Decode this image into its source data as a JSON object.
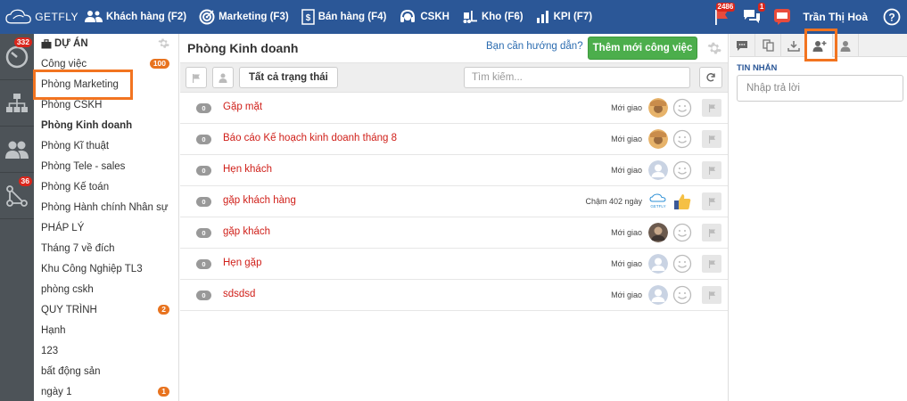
{
  "brand": {
    "name": "GETFLY"
  },
  "nav": [
    {
      "label": "Khách hàng (F2)",
      "icon": "users-icon"
    },
    {
      "label": "Marketing (F3)",
      "icon": "target-icon"
    },
    {
      "label": "Bán hàng (F4)",
      "icon": "dollar-doc-icon"
    },
    {
      "label": "CSKH",
      "icon": "headset-icon"
    },
    {
      "label": "Kho (F6)",
      "icon": "forklift-icon"
    },
    {
      "label": "KPI (F7)",
      "icon": "chart-icon"
    }
  ],
  "top_right": {
    "flag_badge": "2486",
    "chat_badge": "1",
    "user_name": "Trần Thị Hoà"
  },
  "rail": [
    {
      "icon": "dashboard-icon",
      "badge": "332"
    },
    {
      "icon": "org-chart-icon",
      "badge": ""
    },
    {
      "icon": "people-icon",
      "badge": ""
    },
    {
      "icon": "workflow-icon",
      "badge": "36"
    }
  ],
  "projects": {
    "header": "DỰ ÁN",
    "items": [
      {
        "label": "Công việc",
        "count": "100",
        "bold": false
      },
      {
        "label": "Phòng Marketing",
        "count": "",
        "bold": false
      },
      {
        "label": "Phòng CSKH",
        "count": "",
        "bold": false
      },
      {
        "label": "Phòng Kinh doanh",
        "count": "",
        "bold": true
      },
      {
        "label": "Phòng Kĩ thuật",
        "count": "",
        "bold": false
      },
      {
        "label": "Phòng Tele - sales",
        "count": "",
        "bold": false
      },
      {
        "label": "Phòng Kế toán",
        "count": "",
        "bold": false
      },
      {
        "label": "Phòng Hành chính Nhân sự",
        "count": "",
        "bold": false
      },
      {
        "label": "PHÁP LÝ",
        "count": "",
        "bold": false
      },
      {
        "label": "Tháng 7 về đích",
        "count": "",
        "bold": false
      },
      {
        "label": "Khu Công Nghiệp TL3",
        "count": "",
        "bold": false
      },
      {
        "label": "phòng cskh",
        "count": "",
        "bold": false
      },
      {
        "label": "QUY TRÌNH",
        "count": "2",
        "bold": false
      },
      {
        "label": "Hạnh",
        "count": "",
        "bold": false
      },
      {
        "label": "123",
        "count": "",
        "bold": false
      },
      {
        "label": "bất động sản",
        "count": "",
        "bold": false
      },
      {
        "label": "ngày 1",
        "count": "1",
        "bold": false
      }
    ]
  },
  "main": {
    "title": "Phòng Kinh doanh",
    "guide_link": "Bạn cần hướng dẫn?",
    "add_button": "Thêm mới công việc",
    "status_filter": "Tất cả trạng thái",
    "search_placeholder": "Tìm kiếm...",
    "tasks": [
      {
        "num": "0",
        "name": "Gặp mặt",
        "status": "Mới giao",
        "avatar": "photo",
        "reaction": "smile"
      },
      {
        "num": "0",
        "name": "Báo cáo Kế hoạch kinh doanh tháng 8",
        "status": "Mới giao",
        "avatar": "photo",
        "reaction": "smile"
      },
      {
        "num": "0",
        "name": "Hẹn khách",
        "status": "Mới giao",
        "avatar": "default",
        "reaction": "smile"
      },
      {
        "num": "0",
        "name": "gặp khách hàng",
        "status": "Chậm 402 ngày",
        "avatar": "getfly",
        "reaction": "thumbs-up"
      },
      {
        "num": "0",
        "name": "gặp khách",
        "status": "Mới giao",
        "avatar": "photo-dark",
        "reaction": "smile"
      },
      {
        "num": "0",
        "name": "Hẹn gặp",
        "status": "Mới giao",
        "avatar": "default",
        "reaction": "smile"
      },
      {
        "num": "0",
        "name": "sdsdsd",
        "status": "Mới giao",
        "avatar": "default",
        "reaction": "smile"
      }
    ]
  },
  "right_panel": {
    "tabs": [
      "chat-bubble-icon",
      "copy-icon",
      "download-icon",
      "add-user-icon",
      "user-icon"
    ],
    "active_tab": 3,
    "message_label": "TIN NHẮN",
    "reply_placeholder": "Nhập trả lời"
  },
  "colors": {
    "topbar": "#2b5797",
    "rail": "#4d5358",
    "accent_green": "#4cae4c",
    "task_red": "#d0201a",
    "badge_red": "#d9261c",
    "badge_orange": "#e8731f",
    "highlight": "#f27420"
  }
}
